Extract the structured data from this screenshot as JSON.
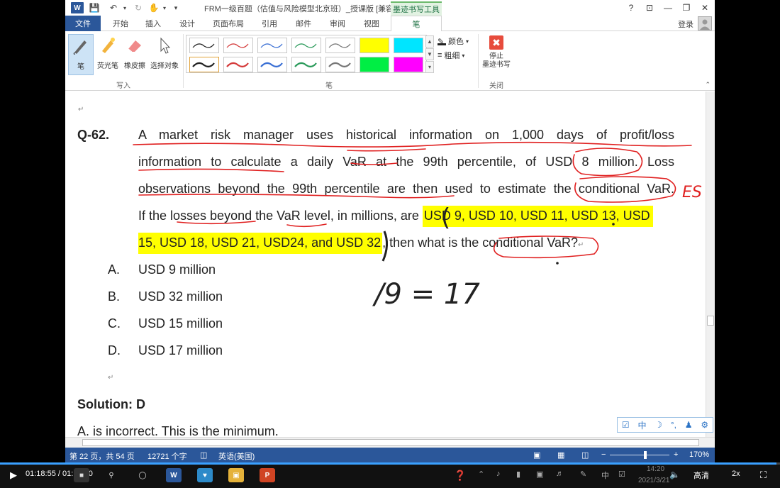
{
  "window": {
    "title": "FRM一级百题（估值与风险模型北京班）_授课版 [兼容...",
    "contextual_tab": "墨迹书写工具",
    "help": "?",
    "restore_ribbon": "⊡",
    "minimize": "—",
    "maximize": "❐",
    "close": "✕"
  },
  "tabs": {
    "file": "文件",
    "items": [
      "开始",
      "插入",
      "设计",
      "页面布局",
      "引用",
      "邮件",
      "审阅",
      "视图"
    ],
    "active": "笔",
    "login": "登录"
  },
  "ribbon": {
    "tools": [
      "笔",
      "荧光笔",
      "橡皮擦",
      "选择对象"
    ],
    "group_write": "写入",
    "group_pen": "笔",
    "group_close": "关闭",
    "color": "颜色",
    "thickness": "粗细",
    "stop_line1": "停止",
    "stop_line2": "墨迹书写",
    "pen_colors_row1": [
      "#222222",
      "#d43a3a",
      "#3a6fd4",
      "#2a9a5a",
      "#777777",
      "#ffff00",
      "#00e5ff"
    ],
    "pen_colors_row2": [
      "#222222",
      "#d43a3a",
      "#3a6fd4",
      "#2a9a5a",
      "#777777",
      "#00ee44",
      "#ff00ff"
    ]
  },
  "document": {
    "q_label": "Q-62.",
    "q_line1": "A market risk manager uses historical information on 1,000 days of profit/loss",
    "q_line2": "information to calculate a daily VaR at the 99th percentile, of USD 8 million. Loss",
    "q_line3": "observations beyond the 99th percentile are then used to estimate the conditional VaR.",
    "q_line4a": "If the losses beyond the VaR level, in millions, are ",
    "q_line4b": "USD 9, USD 10, USD 11, USD 13, USD",
    "q_line5a": "15, USD 18, USD 21, USD24, and USD 32",
    "q_line5b": ", then what is the conditional VaR?",
    "options": [
      {
        "letter": "A.",
        "text": "USD 9 million"
      },
      {
        "letter": "B.",
        "text": "USD 32 million"
      },
      {
        "letter": "C.",
        "text": "USD 15 million"
      },
      {
        "letter": "D.",
        "text": "USD 17 million"
      }
    ],
    "solution": "Solution: D",
    "solution_a": "A. is incorrect. This is the minimum."
  },
  "ink": {
    "es": "ES",
    "calc": "/9 = 17",
    "paren": "("
  },
  "ime": {
    "items": [
      "☑",
      "中",
      "☽",
      "°,",
      "♟",
      "⚙"
    ]
  },
  "status": {
    "page": "第 22 页，共 54 页",
    "words": "12721 个字",
    "lang": "英语(美国)",
    "zoom": "170%",
    "zoom_minus": "−",
    "zoom_plus": "+"
  },
  "player": {
    "time": "01:18:55 / 01:19:20",
    "clock_time": "14:20",
    "clock_date": "2021/3/21",
    "quality": "高清",
    "speed": "2x",
    "progress": 0.995
  },
  "colors": {
    "word_blue": "#2b579a",
    "ink_red": "#e02020",
    "highlight": "#ffff00"
  }
}
